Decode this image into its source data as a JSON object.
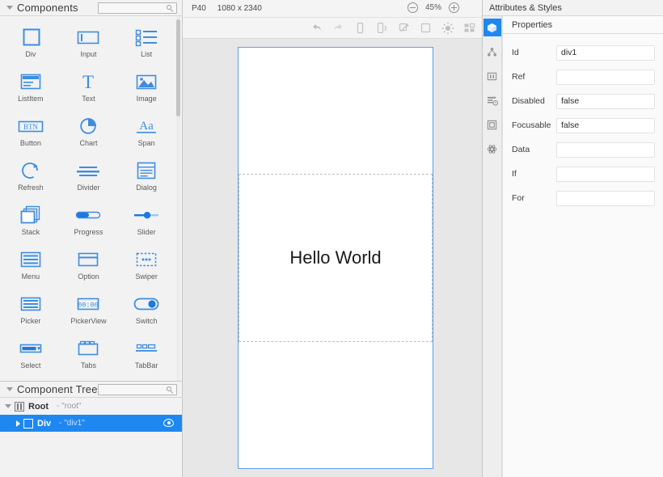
{
  "left": {
    "components_panel": {
      "title": "Components",
      "search_placeholder": "",
      "search_value": "",
      "items": [
        {
          "label": "Div",
          "icon": "div-icon"
        },
        {
          "label": "Input",
          "icon": "input-icon"
        },
        {
          "label": "List",
          "icon": "list-icon"
        },
        {
          "label": "ListItem",
          "icon": "listitem-icon"
        },
        {
          "label": "Text",
          "icon": "text-icon"
        },
        {
          "label": "Image",
          "icon": "image-icon"
        },
        {
          "label": "Button",
          "icon": "button-icon"
        },
        {
          "label": "Chart",
          "icon": "chart-icon"
        },
        {
          "label": "Span",
          "icon": "span-icon"
        },
        {
          "label": "Refresh",
          "icon": "refresh-icon"
        },
        {
          "label": "Divider",
          "icon": "divider-icon"
        },
        {
          "label": "Dialog",
          "icon": "dialog-icon"
        },
        {
          "label": "Stack",
          "icon": "stack-icon"
        },
        {
          "label": "Progress",
          "icon": "progress-icon"
        },
        {
          "label": "Slider",
          "icon": "slider-icon"
        },
        {
          "label": "Menu",
          "icon": "menu-icon"
        },
        {
          "label": "Option",
          "icon": "option-icon"
        },
        {
          "label": "Swiper",
          "icon": "swiper-icon"
        },
        {
          "label": "Picker",
          "icon": "picker-icon"
        },
        {
          "label": "PickerView",
          "icon": "pickerview-icon"
        },
        {
          "label": "Switch",
          "icon": "switch-icon"
        },
        {
          "label": "Select",
          "icon": "select-icon"
        },
        {
          "label": "Tabs",
          "icon": "tabs-icon"
        },
        {
          "label": "TabBar",
          "icon": "tabbar-icon"
        }
      ]
    },
    "tree_panel": {
      "title": "Component Tree",
      "search_placeholder": "",
      "search_value": "",
      "nodes": [
        {
          "label": "Root",
          "detail": "- \"root\"",
          "selected": false
        },
        {
          "label": "Div",
          "detail": "- \"div1\"",
          "selected": true
        }
      ]
    }
  },
  "center": {
    "device_name": "P40",
    "resolution": "1080 x 2340",
    "zoom_out_icon": "minus-circle-icon",
    "zoom_level": "45%",
    "zoom_in_icon": "plus-circle-icon",
    "toolbar_icons": [
      "undo-icon",
      "redo-icon",
      "portrait-icon",
      "landscape-icon",
      "rotate-icon",
      "square-icon",
      "brightness-icon",
      "layout-icon"
    ],
    "preview_text": "Hello World"
  },
  "right": {
    "title": "Attributes & Styles",
    "rail_icons": [
      "cube-icon",
      "nodes-icon",
      "columns-icon",
      "form-icon",
      "frame-icon",
      "atom-icon"
    ],
    "section_title": "Properties",
    "properties": [
      {
        "label": "Id",
        "value": "div1"
      },
      {
        "label": "Ref",
        "value": ""
      },
      {
        "label": "Disabled",
        "value": "false"
      },
      {
        "label": "Focusable",
        "value": "false"
      },
      {
        "label": "Data",
        "value": ""
      },
      {
        "label": "If",
        "value": ""
      },
      {
        "label": "For",
        "value": ""
      }
    ]
  },
  "colors": {
    "accent": "#1e88f0",
    "icon_blue": "#3c8de0",
    "panel_bg": "#f2f2f2",
    "canvas_bg": "#e7e7e7",
    "phone_border": "#5d9ee8"
  }
}
